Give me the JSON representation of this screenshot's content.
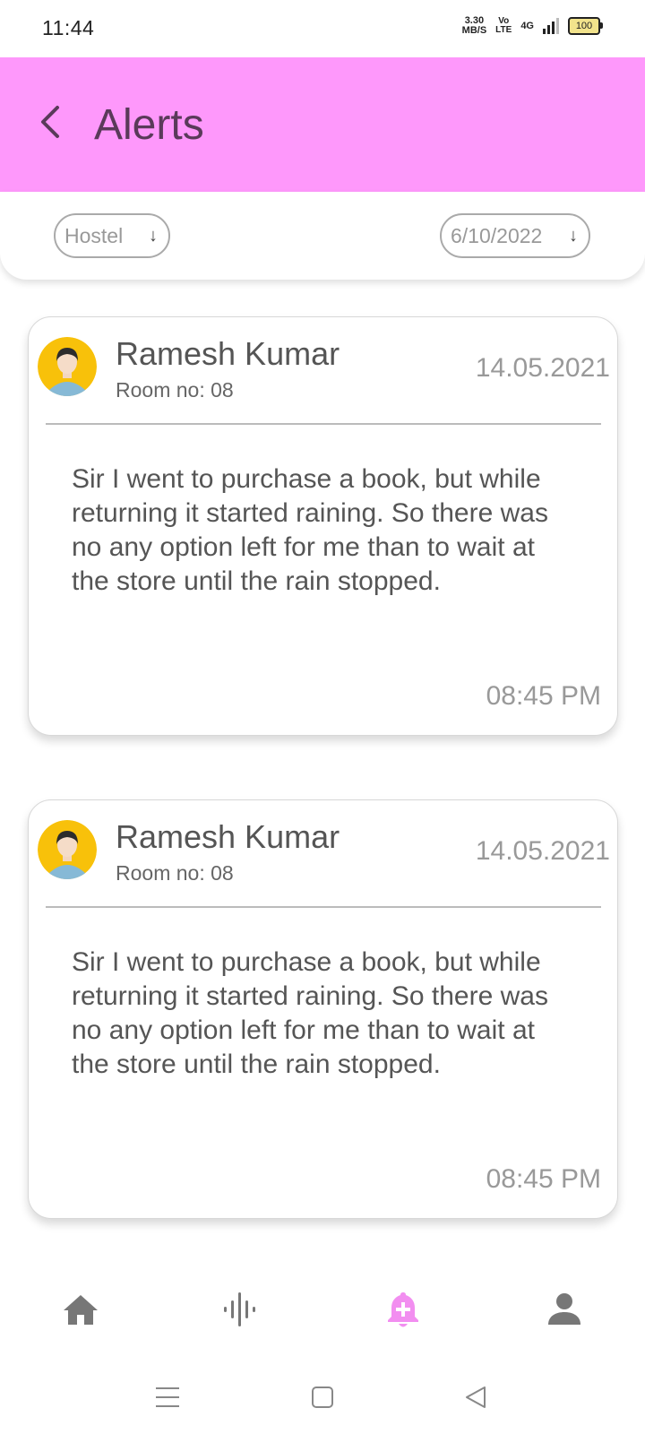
{
  "status_bar": {
    "time": "11:44",
    "net_speed_value": "3.30",
    "net_speed_unit": "MB/S",
    "volte_top": "Vo",
    "volte_bottom": "LTE",
    "network": "4G",
    "battery": "100"
  },
  "header": {
    "title": "Alerts",
    "background": "#fe98fb"
  },
  "filters": {
    "hostel_label": "Hostel",
    "date_label": "6/10/2022",
    "arrow": "↓"
  },
  "alerts": [
    {
      "name": "Ramesh Kumar",
      "room": "Room no: 08",
      "date": "14.05.2021",
      "message": "Sir I went to purchase a book, but while returning it started raining. So there was no any option left for me than to wait at the store until the rain stopped.",
      "time": "08:45 PM"
    },
    {
      "name": "Ramesh Kumar",
      "room": "Room no: 08",
      "date": "14.05.2021",
      "message": "Sir I went to purchase a book, but while returning it started raining. So there was no any option left for me than to wait at the store until the rain stopped.",
      "time": "08:45 PM"
    }
  ],
  "bottom_nav": {
    "items": [
      {
        "icon": "home-icon",
        "active": false
      },
      {
        "icon": "voice-wave-icon",
        "active": false
      },
      {
        "icon": "bell-plus-icon",
        "active": true
      },
      {
        "icon": "person-icon",
        "active": false
      }
    ],
    "active_color": "#f28ef0",
    "inactive_color": "#777777"
  },
  "system_nav": {
    "items": [
      "menu-icon",
      "home-square-icon",
      "back-triangle-icon"
    ]
  }
}
